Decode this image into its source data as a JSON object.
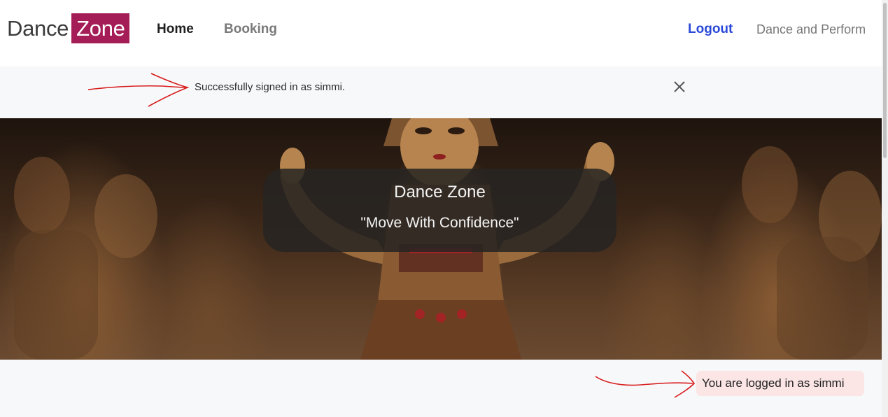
{
  "navbar": {
    "brand_part1": "Dance",
    "brand_part2": "Zone",
    "links": [
      {
        "label": "Home"
      },
      {
        "label": "Booking"
      }
    ],
    "logout_label": "Logout",
    "tagline": "Dance and Perform"
  },
  "alert": {
    "message": "Successfully signed in as simmi.",
    "close_icon": "close-icon"
  },
  "hero": {
    "title": "Dance Zone",
    "subtitle": "\"Move With Confidence\""
  },
  "status": {
    "logged_in_text": "You are logged in as simmi"
  },
  "colors": {
    "brand_accent": "#a51d56",
    "logout_link": "#2a49d8",
    "annotation_red": "#d81b1b",
    "badge_background": "#fbe5e5"
  }
}
